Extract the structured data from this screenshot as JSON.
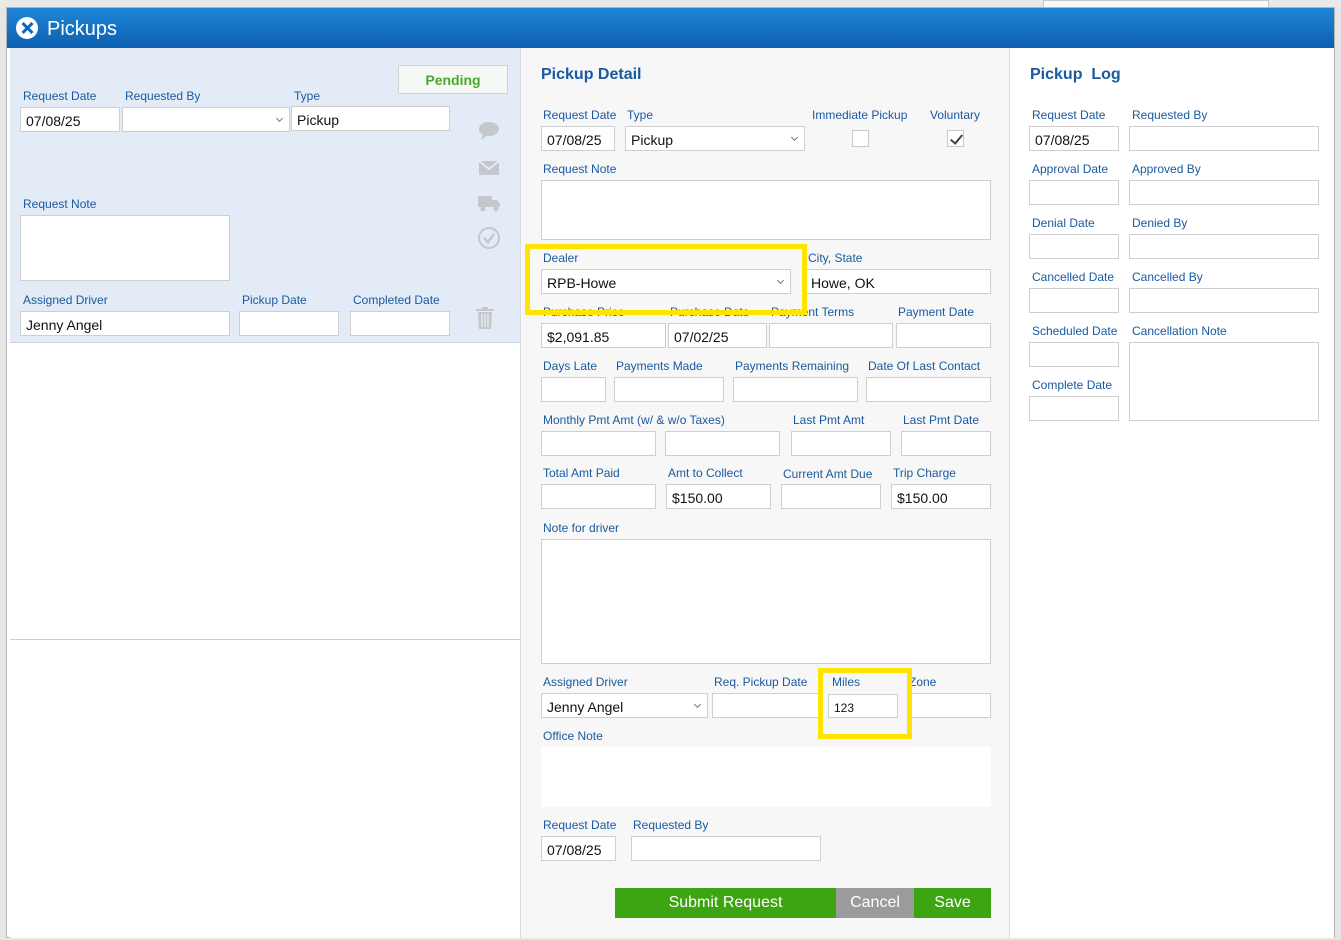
{
  "window": {
    "title": "Pickups"
  },
  "left": {
    "status": "Pending",
    "labels": {
      "request_date": "Request Date",
      "requested_by": "Requested By",
      "type": "Type",
      "request_note": "Request Note",
      "assigned_driver": "Assigned Driver",
      "pickup_date": "Pickup Date",
      "completed_date": "Completed Date"
    },
    "values": {
      "request_date": "07/08/25",
      "requested_by": "",
      "type": "Pickup",
      "assigned_driver": "Jenny Angel",
      "pickup_date": "",
      "completed_date": ""
    },
    "icons": [
      "comment-icon",
      "envelope-icon",
      "truck-icon",
      "check-circle-icon",
      "trash-icon"
    ]
  },
  "detail": {
    "heading": "Pickup Detail",
    "labels": {
      "request_date": "Request Date",
      "type": "Type",
      "immediate_pickup": "Immediate Pickup",
      "voluntary": "Voluntary",
      "request_note": "Request Note",
      "dealer": "Dealer",
      "city_state": "City, State",
      "purchase_price": "Purchase Price",
      "purchase_date": "Purchase Date",
      "payment_terms": "Payment Terms",
      "payment_date": "Payment Date",
      "days_late": "Days Late",
      "payments_made": "Payments Made",
      "payments_remaining": "Payments Remaining",
      "date_last_contact": "Date Of Last Contact",
      "monthly_pmt": "Monthly Pmt Amt (w/ & w/o Taxes)",
      "last_pmt_amt": "Last Pmt Amt",
      "last_pmt_date": "Last Pmt Date",
      "total_amt_paid": "Total Amt Paid",
      "amt_to_collect": "Amt to Collect",
      "current_amt_due": "Current Amt Due",
      "trip_charge": "Trip Charge",
      "note_for_driver": "Note for driver",
      "assigned_driver": "Assigned Driver",
      "req_pickup_date": "Req. Pickup Date",
      "miles": "Miles",
      "zone": "Zone",
      "office_note": "Office Note",
      "request_date_2": "Request Date",
      "requested_by_2": "Requested By"
    },
    "values": {
      "request_date": "07/08/25",
      "type": "Pickup",
      "immediate_pickup": false,
      "voluntary": true,
      "dealer": "RPB-Howe",
      "city_state": "Howe, OK",
      "purchase_price": "$2,091.85",
      "purchase_date": "07/02/25",
      "amt_to_collect": "$150.00",
      "trip_charge": "$150.00",
      "assigned_driver": "Jenny Angel",
      "miles": "123",
      "request_date_2": "07/08/25"
    },
    "buttons": {
      "submit": "Submit Request",
      "cancel": "Cancel",
      "save": "Save"
    },
    "colors": {
      "submit": "#3da412",
      "cancel": "#9b9b9b",
      "save": "#3da412",
      "highlight": "#ffe400"
    }
  },
  "log": {
    "heading": "Pickup  Log",
    "labels": {
      "request_date": "Request Date",
      "requested_by": "Requested By",
      "approval_date": "Approval Date",
      "approved_by": "Approved By",
      "denial_date": "Denial Date",
      "denied_by": "Denied By",
      "cancelled_date": "Cancelled Date",
      "cancelled_by": "Cancelled By",
      "scheduled_date": "Scheduled Date",
      "cancellation_note": "Cancellation Note",
      "complete_date": "Complete Date"
    },
    "values": {
      "request_date": "07/08/25"
    }
  }
}
